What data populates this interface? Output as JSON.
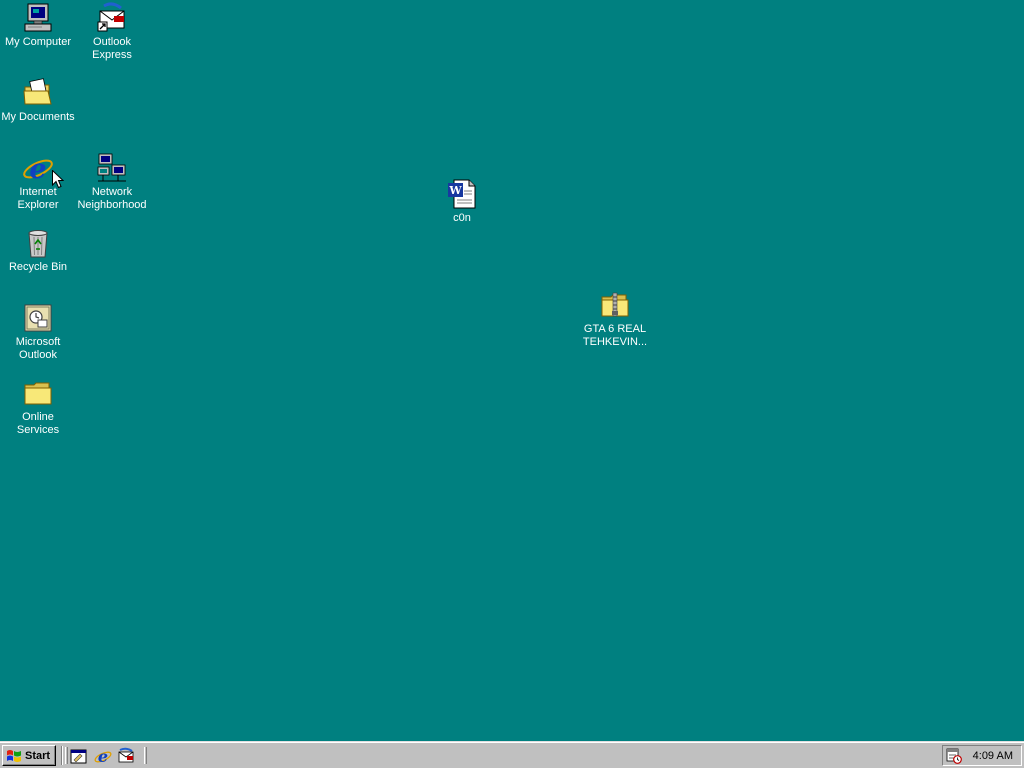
{
  "desktop": {
    "background_color": "#008080",
    "icons": {
      "my_computer": {
        "label": "My Computer",
        "icon": "computer-icon"
      },
      "outlook_express": {
        "label": "Outlook\nExpress",
        "icon": "outlook-express-icon"
      },
      "my_documents": {
        "label": "My Documents",
        "icon": "documents-folder-icon"
      },
      "internet_explorer": {
        "label": "Internet\nExplorer",
        "icon": "internet-explorer-icon"
      },
      "network_neighborhood": {
        "label": "Network\nNeighborhood",
        "icon": "network-icon"
      },
      "recycle_bin": {
        "label": "Recycle Bin",
        "icon": "recycle-bin-icon"
      },
      "microsoft_outlook": {
        "label": "Microsoft\nOutlook",
        "icon": "outlook-icon"
      },
      "online_services": {
        "label": "Online\nServices",
        "icon": "folder-icon"
      },
      "c0n": {
        "label": "c0n",
        "icon": "word-document-icon"
      },
      "gta6": {
        "label": "GTA 6 REAL\nTEHKEVIN...",
        "icon": "zip-folder-icon"
      }
    }
  },
  "taskbar": {
    "start_label": "Start",
    "quick_launch": [
      "show-desktop-icon",
      "internet-explorer-icon",
      "outlook-express-icon"
    ],
    "tray": {
      "clock": "4:09 AM",
      "icon": "task-scheduler-icon"
    }
  }
}
